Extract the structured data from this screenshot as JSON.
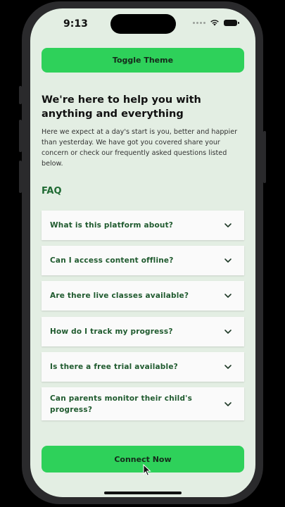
{
  "status_bar": {
    "time": "9:13"
  },
  "toggle_button": {
    "label": "Toggle Theme"
  },
  "intro": {
    "headline": "We're here to help you with anything and everything",
    "body": "Here we expect at a day's start is you, better and happier than yesterday. We have got you covered share your concern or check our frequently asked questions listed below."
  },
  "faq": {
    "title": "FAQ",
    "items": [
      {
        "question": "What is this platform about?"
      },
      {
        "question": "Can I access content offline?"
      },
      {
        "question": "Are there live classes available?"
      },
      {
        "question": "How do I track my progress?"
      },
      {
        "question": "Is there a free trial available?"
      },
      {
        "question": "Can parents monitor their child's progress?"
      }
    ]
  },
  "connect_button": {
    "label": "Connect Now"
  },
  "colors": {
    "background": "#e3eee3",
    "accent": "#2ed15a",
    "faq_text": "#1f5a2e",
    "faq_title": "#1f6a33"
  },
  "icons": {
    "expand": "chevron-down-icon",
    "wifi": "wifi-icon",
    "battery": "battery-icon",
    "cursor": "mouse-pointer-icon"
  }
}
